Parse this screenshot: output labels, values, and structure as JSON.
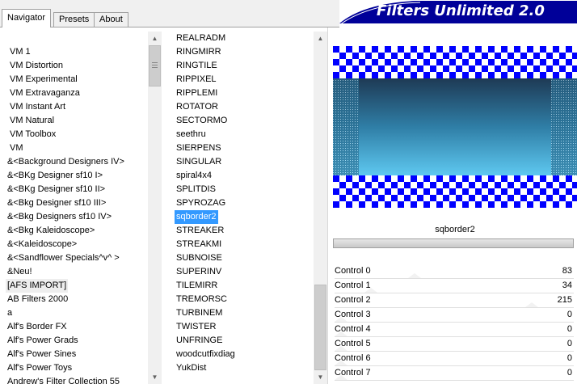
{
  "window": {
    "title": "Filters Unlimited 2.0",
    "tabs": [
      "Navigator",
      "Presets",
      "About"
    ]
  },
  "categories": [
    "VM 1",
    "VM Distortion",
    "VM Experimental",
    "VM Extravaganza",
    "VM Instant Art",
    "VM Natural",
    "VM Toolbox",
    "VM",
    "&<Background Designers IV>",
    "&<BKg Designer sf10 I>",
    "&<BKg Designer sf10 II>",
    "&<Bkg Designer sf10 III>",
    "&<Bkg Designers sf10 IV>",
    "&<Bkg Kaleidoscope>",
    "&<Kaleidoscope>",
    "&<Sandflower Specials^v^ >",
    "&Neu!",
    "[AFS IMPORT]",
    "AB Filters 2000",
    "a",
    "Alf's Border FX",
    "Alf's Power Grads",
    "Alf's Power Sines",
    "Alf's Power Toys",
    "Andrew's Filter Collection 55"
  ],
  "filters": [
    "REALRADM",
    "RINGMIRR",
    "RINGTILE",
    "RIPPIXEL",
    "RIPPLEMI",
    "ROTATOR",
    "SECTORMO",
    "seethru",
    "SIERPENS",
    "SINGULAR",
    "spiral4x4",
    "SPLITDIS",
    "SPYROZAG",
    "sqborder2",
    "STREAKER",
    "STREAKMI",
    "SUBNOISE",
    "SUPERINV",
    "TILEMIRR",
    "TREMORSC",
    "TURBINEM",
    "TWISTER",
    "UNFRINGE",
    "woodcutfixdiag",
    "YukDist"
  ],
  "selected_filter": "sqborder2",
  "selected_filter_index": 13,
  "controls": [
    {
      "label": "Control 0",
      "value": "83"
    },
    {
      "label": "Control 1",
      "value": "34"
    },
    {
      "label": "Control 2",
      "value": "215"
    },
    {
      "label": "Control 3",
      "value": "0"
    },
    {
      "label": "Control 4",
      "value": "0"
    },
    {
      "label": "Control 5",
      "value": "0"
    },
    {
      "label": "Control 6",
      "value": "0"
    },
    {
      "label": "Control 7",
      "value": "0"
    }
  ],
  "colors": {
    "title_banner": "#000099",
    "checker": "#0000ff",
    "selection": "#3399ff",
    "gradient_top": "#1e3a55",
    "gradient_bottom": "#5ec8f0"
  }
}
